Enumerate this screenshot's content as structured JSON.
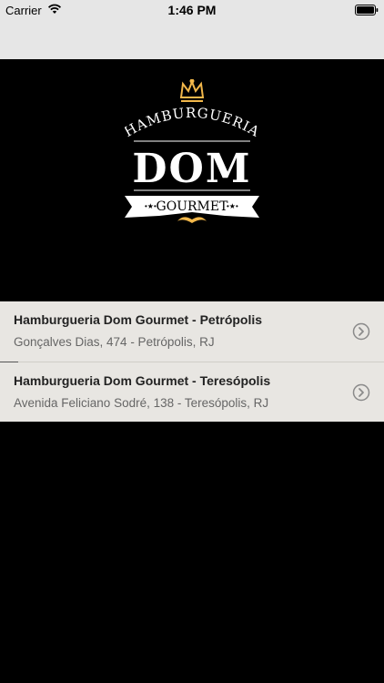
{
  "status": {
    "carrier": "Carrier",
    "time": "1:46 PM"
  },
  "logo": {
    "line1": "HAMBURGUERIA",
    "line2": "DOM",
    "line3": "GOURMET",
    "color": "#f2b74a"
  },
  "locations": [
    {
      "name": "Hamburgueria Dom Gourmet - Petrópolis",
      "address": "Gonçalves Dias, 474 - Petrópolis, RJ"
    },
    {
      "name": "Hamburgueria Dom Gourmet - Teresópolis",
      "address": "Avenida Feliciano Sodré, 138 - Teresópolis, RJ"
    }
  ]
}
